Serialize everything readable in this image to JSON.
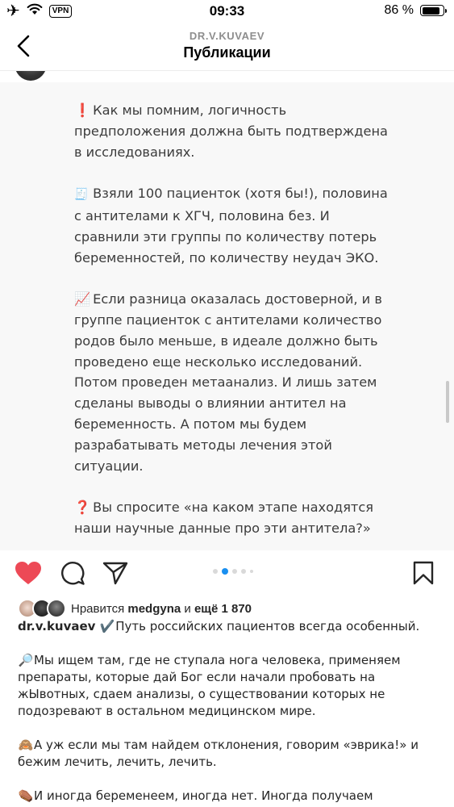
{
  "status_bar": {
    "time": "09:33",
    "vpn": "VPN",
    "battery": "86 %",
    "battery_level": 0.86
  },
  "header": {
    "username": "DR.V.KUVAEV",
    "title": "Публикации"
  },
  "post": {
    "paragraphs": [
      {
        "icon": "exclamation-icon",
        "glyph": "❗",
        "text": "Как мы помним, логичность предположения должна быть подтверждена в исследованиях."
      },
      {
        "icon": "document-icon",
        "glyph": "🧾",
        "text": "Взяли 100 пациенток (хотя бы!), половина с антителами к ХГЧ, половина без. И сравнили эти группы по количеству потерь беременностей, по количеству неудач ЭКО."
      },
      {
        "icon": "chart-increasing-icon",
        "glyph": "📈",
        "text": "Если разница оказалась достоверной, и в группе пациенток с антителами количество родов было меньше, в идеале должно быть проведено еще несколько исследований. Потом проведен метаанализ. И лишь затем сделаны выводы о влиянии антител на беременность. А потом мы будем разрабатывать методы лечения этой ситуации."
      },
      {
        "icon": "question-icon",
        "glyph": "❓",
        "text": "Вы спросите «на каком этапе находятся наши научные данные про эти антитела?»"
      }
    ],
    "carousel_index": 2,
    "carousel_count": 5
  },
  "likes": {
    "prefix": "Нравится",
    "user": "medgyna",
    "joiner": "и",
    "more": "ещё 1 870"
  },
  "caption": {
    "username": "dr.v.kuvaev",
    "lead_icon": "check-mark-icon",
    "lead_glyph": "✔️",
    "lead_text": "Путь российских пациентов всегда особенный.",
    "paragraphs": [
      {
        "icon": "magnifier-icon",
        "glyph": "🔎",
        "text": "Мы ищем там, где не ступала нога человека, применяем препараты, которые дай Бог если начали пробовать на жЫвотных, сдаем анализы, о существовании которых не подозревают в остальном медицинском мире."
      },
      {
        "icon": "see-no-evil-monkey-icon",
        "glyph": "🙈",
        "text": "А уж если мы там найдем отклонения, говорим «эврика!» и бежим лечить, лечить, лечить."
      },
      {
        "icon": "coffin-icon",
        "glyph": "⚰️",
        "text": "И иногда беременеем, иногда нет. Иногда получаем"
      }
    ]
  },
  "colors": {
    "like_red": "#ed4956",
    "carousel_active": "#1a8ff0",
    "text": "#262626",
    "muted": "#8e8e8e"
  }
}
